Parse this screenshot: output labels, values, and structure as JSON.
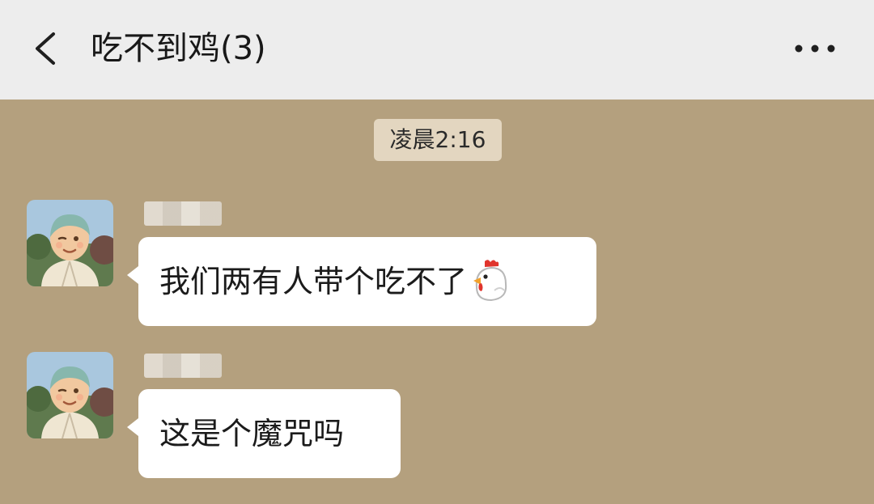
{
  "header": {
    "title": "吃不到鸡(3)",
    "back_icon": "chevron-left-icon",
    "more_icon": "more-dots-icon"
  },
  "chat": {
    "timestamp": "凌晨2:16",
    "messages": [
      {
        "text": "我们两有人带个吃不了",
        "emoji": "chicken-emoji-icon"
      },
      {
        "text": "这是个魔咒吗"
      }
    ]
  },
  "colors": {
    "header_bg": "#ededed",
    "chat_bg": "#b4a07e",
    "bubble_bg": "#ffffff",
    "timestamp_bg": "#e3d6c0"
  }
}
